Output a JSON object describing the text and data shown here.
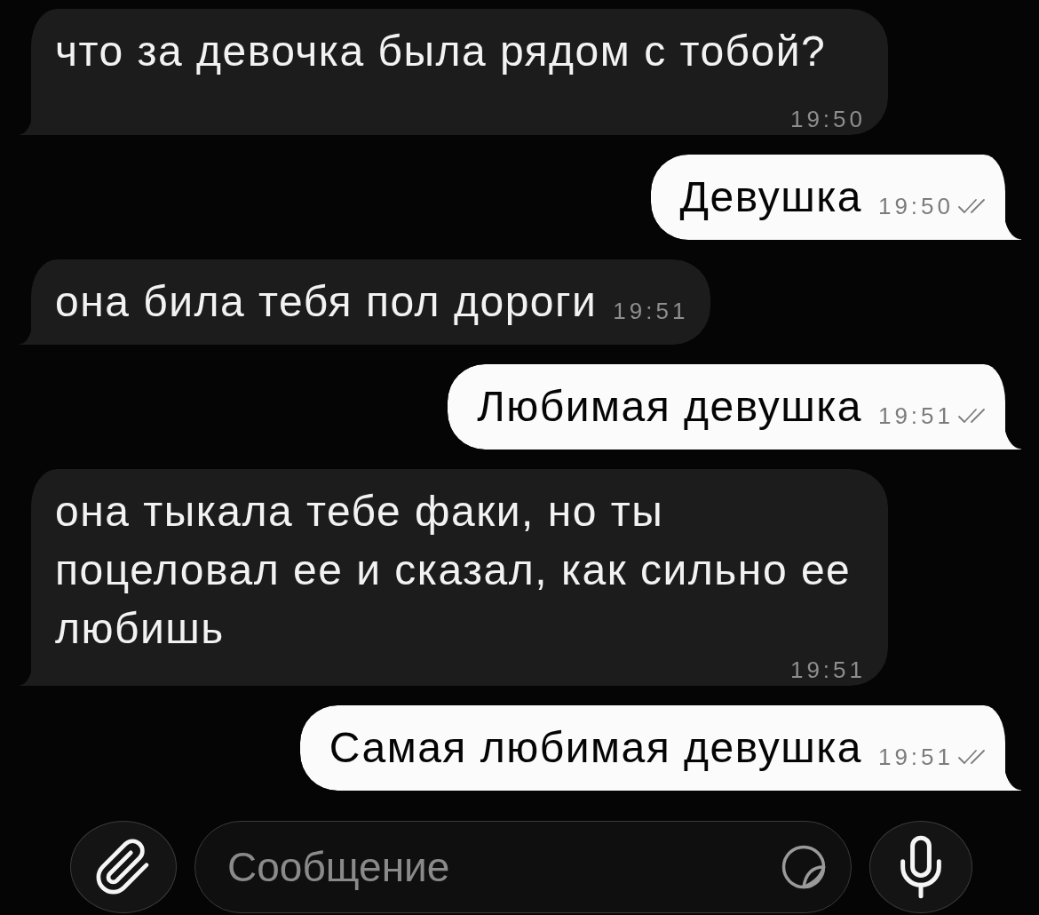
{
  "messages": [
    {
      "kind": "incoming",
      "text": "что за девочка была рядом с тобой?",
      "time": "19:50"
    },
    {
      "kind": "outgoing",
      "text": "Девушка",
      "time": "19:50",
      "read": true
    },
    {
      "kind": "incoming",
      "text": "она била тебя пол дороги",
      "time": "19:51"
    },
    {
      "kind": "outgoing",
      "text": "Любимая девушка",
      "time": "19:51",
      "read": true
    },
    {
      "kind": "incoming",
      "text": "она тыкала тебе факи, но ты поцеловал ее и сказал, как сильно ее любишь",
      "time": "19:51"
    },
    {
      "kind": "outgoing",
      "text": "Самая любимая девушка",
      "time": "19:51",
      "read": true
    }
  ],
  "composer": {
    "placeholder": "Сообщение"
  }
}
